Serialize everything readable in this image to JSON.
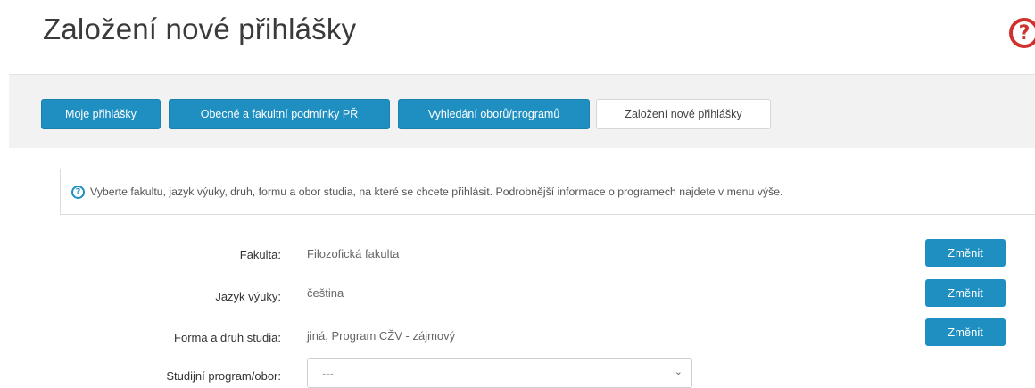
{
  "header": {
    "title": "Založení nové přihlášky",
    "help_icon": "?"
  },
  "tabs": [
    {
      "label": "Moje přihlášky"
    },
    {
      "label": "Obecné a fakultní podmínky PŘ"
    },
    {
      "label": "Vyhledání oborů/programů"
    },
    {
      "label": "Založení nové přihlášky"
    }
  ],
  "info": {
    "icon": "?",
    "text": "Vyberte fakultu, jazyk výuky, druh, formu a obor studia, na které se chcete přihlásit. Podrobnější informace o programech najdete v menu výše."
  },
  "form": {
    "fakulta_label": "Fakulta:",
    "fakulta_value": "Filozofická fakulta",
    "jazyk_label": "Jazyk výuky:",
    "jazyk_value": "čeština",
    "forma_label": "Forma a druh studia:",
    "forma_value": "jiná, Program CŽV - zájmový",
    "program_label": "Studijní program/obor:",
    "program_select_value": "---",
    "change_label": "Změnit"
  },
  "colors": {
    "primary": "#1f8fc1",
    "help": "#d0312d"
  }
}
